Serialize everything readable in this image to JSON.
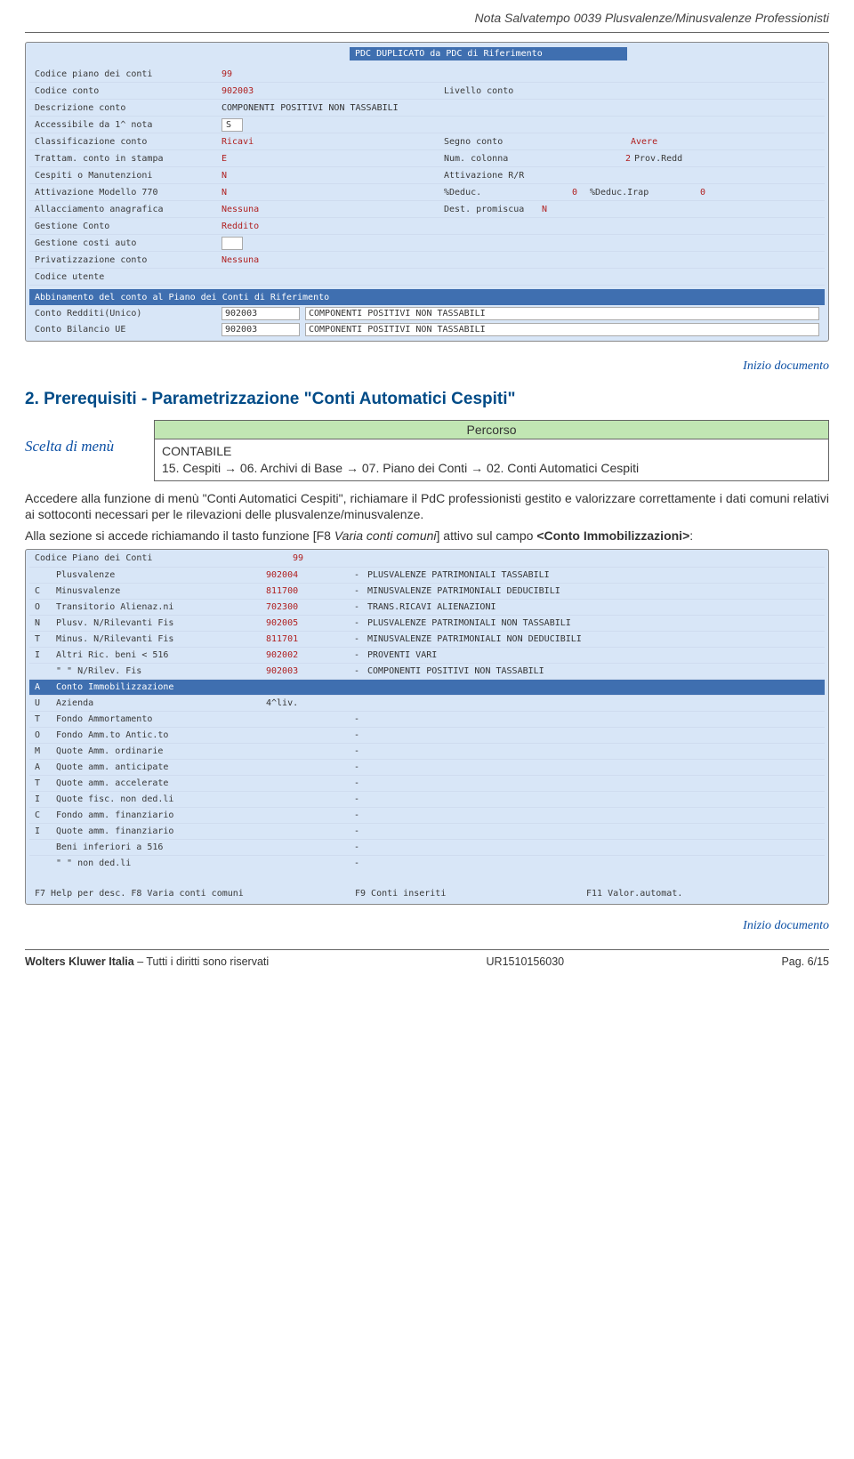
{
  "header": {
    "title": "Nota Salvatempo  0039 Plusvalenze/Minusvalenze Professionisti"
  },
  "screenshot1": {
    "banner": "PDC DUPLICATO da PDC di Riferimento",
    "rows": [
      {
        "l": "Codice piano dei conti",
        "v": "99"
      },
      {
        "l": "Codice conto",
        "v": "902003",
        "l2": "Livello conto",
        "v2": ""
      },
      {
        "l": "Descrizione conto",
        "desc": "COMPONENTI POSITIVI NON TASSABILI"
      },
      {
        "l": "Accessibile da 1^ nota",
        "box": "S"
      },
      {
        "l": "Classificazione conto",
        "v": "Ricavi",
        "l2": "Segno conto",
        "v2": "",
        "l3": "",
        "v3": "Avere"
      },
      {
        "l": "Trattam. conto in stampa",
        "v": "E",
        "l2": "Num. colonna",
        "v2": "2",
        "l3": "Prov.Redd",
        "v3": ""
      },
      {
        "l": "Cespiti o Manutenzioni",
        "v": "N",
        "l2": "Attivazione R/R",
        "v2": ""
      },
      {
        "l": "Attivazione Modello 770",
        "v": "N",
        "l2": "%Deduc.",
        "v2": "0",
        "l3": "%Deduc.Irap",
        "v3": "0"
      },
      {
        "l": "Allacciamento anagrafica",
        "v": "Nessuna",
        "l2": "Dest. promiscua",
        "v2": "N"
      },
      {
        "l": "Gestione Conto",
        "v": "Reddito"
      },
      {
        "l": "Gestione costi auto",
        "v": ""
      },
      {
        "l": "Privatizzazione conto",
        "v": "Nessuna"
      },
      {
        "l": "Codice utente",
        "v": ""
      }
    ],
    "section_head": "Abbinamento del conto al Piano dei Conti di Riferimento",
    "sub": [
      {
        "l": "Conto Redditi(Unico)",
        "code": "902003",
        "desc": "COMPONENTI POSITIVI NON TASSABILI"
      },
      {
        "l": "Conto Bilancio UE",
        "code": "902003",
        "desc": "COMPONENTI POSITIVI NON TASSABILI"
      }
    ]
  },
  "inizio_label": "Inizio documento",
  "section_title": "2. Prerequisiti - Parametrizzazione \"Conti Automatici Cespiti\"",
  "menu": {
    "label": "Scelta di menù",
    "percorso_head": "Percorso",
    "percorso_body_1": "CONTABILE",
    "percorso_body_2": "15. Cespiti → 06. Archivi di Base → 07. Piano dei Conti → 02. Conti Automatici Cespiti"
  },
  "paragraph1": "Accedere alla funzione di menù \"Conti Automatici Cespiti\", richiamare il PdC professionisti gestito e valorizzare correttamente i dati comuni relativi ai sottoconti necessari per le rilevazioni delle plusvalenze/minusvalenze.",
  "paragraph2_pre": "Alla sezione si accede richiamando il tasto funzione [F8 ",
  "paragraph2_em": "Varia conti comuni",
  "paragraph2_mid": "] attivo sul campo ",
  "paragraph2_strong": "<Conto Immobilizzazioni>",
  "paragraph2_post": ":",
  "screenshot2": {
    "top": {
      "lbl": "Codice Piano dei Conti",
      "val": "99"
    },
    "lines": [
      {
        "p": "",
        "n": "Plusvalenze",
        "c": "902004",
        "d": "-",
        "desc": "PLUSVALENZE PATRIMONIALI TASSABILI"
      },
      {
        "p": "C",
        "n": "Minusvalenze",
        "c": "811700",
        "d": "-",
        "desc": "MINUSVALENZE PATRIMONIALI DEDUCIBILI"
      },
      {
        "p": "O",
        "n": "Transitorio Alienaz.ni",
        "c": "702300",
        "d": "-",
        "desc": "TRANS.RICAVI ALIENAZIONI"
      },
      {
        "p": "N",
        "n": "Plusv. N/Rilevanti Fis",
        "c": "902005",
        "d": "-",
        "desc": "PLUSVALENZE PATRIMONIALI NON TASSABILI"
      },
      {
        "p": "T",
        "n": "Minus. N/Rilevanti Fis",
        "c": "811701",
        "d": "-",
        "desc": "MINUSVALENZE PATRIMONIALI NON DEDUCIBILI"
      },
      {
        "p": "I",
        "n": "Altri Ric. beni < 516",
        "c": "902002",
        "d": "-",
        "desc": "PROVENTI VARI"
      },
      {
        "p": "",
        "n": "\"      \"      N/Rilev. Fis",
        "c": "902003",
        "d": "-",
        "desc": "COMPONENTI POSITIVI NON TASSABILI"
      }
    ],
    "hline1": {
      "p": "A",
      "n": "Conto Immobilizzazione",
      "c": "",
      "d": "",
      "desc": ""
    },
    "line_az": {
      "p": "U",
      "n": "Azienda",
      "c": "4^liv.",
      "d": "",
      "desc": ""
    },
    "after": [
      {
        "p": "T",
        "n": "Fondo Ammortamento",
        "c": "",
        "d": "-",
        "desc": ""
      },
      {
        "p": "O",
        "n": "Fondo Amm.to Antic.to",
        "c": "",
        "d": "-",
        "desc": ""
      },
      {
        "p": "M",
        "n": "Quote Amm. ordinarie",
        "c": "",
        "d": "-",
        "desc": ""
      },
      {
        "p": "A",
        "n": "Quote amm. anticipate",
        "c": "",
        "d": "-",
        "desc": ""
      },
      {
        "p": "T",
        "n": "Quote amm. accelerate",
        "c": "",
        "d": "-",
        "desc": ""
      },
      {
        "p": "I",
        "n": "Quote fisc. non ded.li",
        "c": "",
        "d": "-",
        "desc": ""
      },
      {
        "p": "C",
        "n": "Fondo amm. finanziario",
        "c": "",
        "d": "-",
        "desc": ""
      },
      {
        "p": "I",
        "n": "Quote amm. finanziario",
        "c": "",
        "d": "-",
        "desc": ""
      },
      {
        "p": "",
        "n": "Beni inferiori a 516",
        "c": "",
        "d": "-",
        "desc": ""
      },
      {
        "p": "",
        "n": "\"      \"      non ded.li",
        "c": "",
        "d": "-",
        "desc": ""
      }
    ],
    "footer": {
      "f1": "F7 Help per desc. F8 Varia conti comuni",
      "f2": "F9 Conti inseriti",
      "f3": "F11 Valor.automat."
    }
  },
  "footer": {
    "left_strong": "Wolters Kluwer Italia",
    "left_rest": " – Tutti i diritti sono riservati",
    "center": "UR1510156030",
    "right": "Pag.  6/15"
  }
}
